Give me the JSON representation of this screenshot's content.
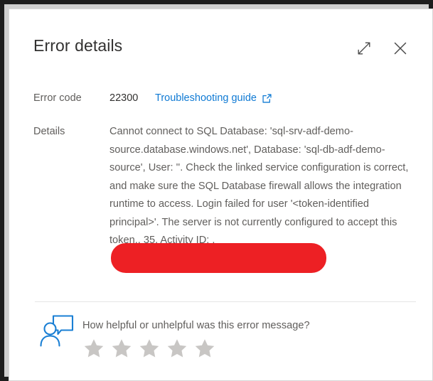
{
  "panel": {
    "title": "Error details",
    "expand_icon": "expand-diagonal-icon",
    "close_icon": "close-icon"
  },
  "fields": {
    "error_code_label": "Error code",
    "error_code_value": "22300",
    "troubleshooting_link_text": "Troubleshooting guide",
    "troubleshooting_link_icon": "external-link-icon",
    "details_label": "Details",
    "details_value": "Cannot connect to SQL Database: 'sql-srv-adf-demo-source.database.windows.net', Database: 'sql-db-adf-demo-source', User: ''. Check the linked service configuration is correct, and make sure the SQL Database firewall allows the integration runtime to access. Login failed for user '<token-identified principal>'. The server is not currently configured to accept this token., 35, Activity ID: ."
  },
  "redaction": {
    "color": "#ed2024",
    "visible_tail_text": "35, Activity ID:"
  },
  "feedback": {
    "icon": "person-feedback-icon",
    "question": "How helpful or unhelpful was this error message?",
    "rating_value": 0,
    "rating_max": 5,
    "star_color": "#c8c6c4"
  },
  "colors": {
    "link": "#0f7ad4",
    "title": "#323130",
    "body_text": "#605e5c",
    "divider": "#e6e6e6",
    "accent_blue": "#0f7ad4"
  }
}
